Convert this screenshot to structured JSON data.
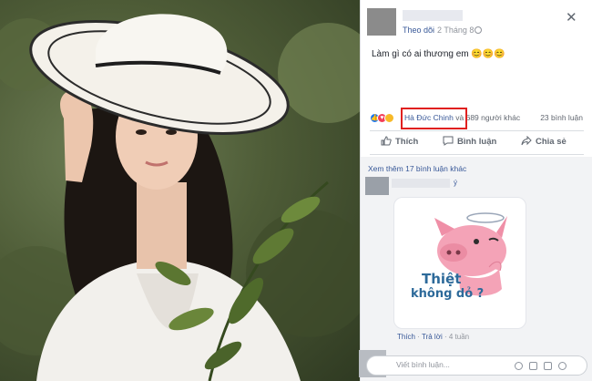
{
  "post": {
    "follow_label": "Theo dõi",
    "separator": "·",
    "timestamp": "2 Tháng 8",
    "status_text": "Làm gì có ai thương em 😊😊😊",
    "reaction_highlight_name": "Hà Đức Chinh",
    "reaction_suffix": "và 689 người khác",
    "comment_count": "23 bình luận",
    "close_symbol": "✕"
  },
  "actions": {
    "like": "Thích",
    "comment": "Bình luận",
    "share": "Chia sẻ"
  },
  "comments": {
    "more_label": "Xem thêm 17 bình luận khác",
    "name_suffix": "ý",
    "sticker_text_line1": "Thiệt",
    "sticker_text_line2": "không dỏ ?",
    "like_label": "Thích",
    "reply_label": "Trả lời",
    "age": "4 tuần"
  },
  "composer": {
    "placeholder": "Viết bình luận..."
  },
  "colors": {
    "highlight_border": "#e0201f",
    "link": "#385898",
    "reaction_like": "#1877f2",
    "reaction_love": "#f33e58",
    "reaction_haha": "#f7b928"
  }
}
